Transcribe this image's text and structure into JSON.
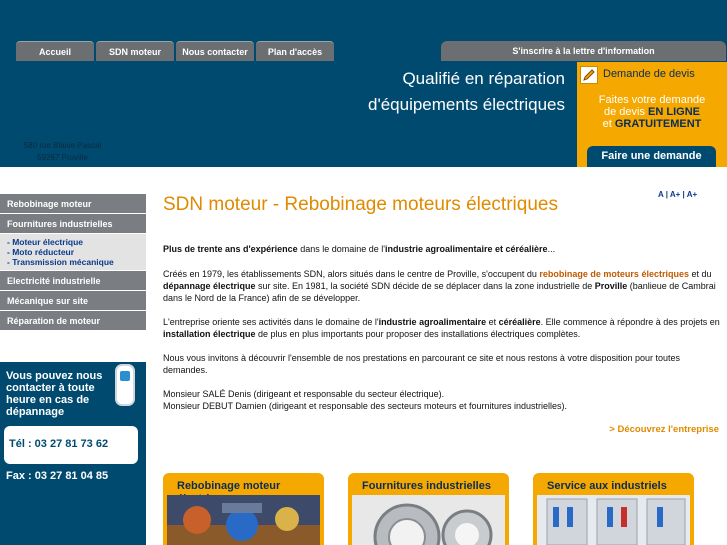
{
  "nav": {
    "tabs": [
      {
        "label": "Accueil"
      },
      {
        "label": "SDN moteur"
      },
      {
        "label": "Nous contacter"
      },
      {
        "label": "Plan d'accès"
      }
    ],
    "newsletter": "S'inscrire à la lettre d'information"
  },
  "header": {
    "tagline_line1": "Qualifié en réparation",
    "tagline_line2": "d'équipements électriques",
    "address_line1": "580 rue Blaise Pascal",
    "address_line2": "59267 Proville"
  },
  "devis": {
    "title": "Demande de devis",
    "text_line1": "Faites votre demande",
    "text_line2_a": "de devis ",
    "text_line2_b": "EN LIGNE",
    "text_line3_a": "et ",
    "text_line3_b": "GRATUITEMENT",
    "button": "Faire une demande"
  },
  "sidebar": {
    "items": [
      {
        "label": "Rebobinage moteur"
      },
      {
        "label": "Fournitures industrielles"
      }
    ],
    "subitems": [
      "- Moteur électrique",
      "- Moto réducteur",
      "- Transmission mécanique"
    ],
    "items_after": [
      {
        "label": "Electricité industrielle"
      },
      {
        "label": "Mécanique sur site"
      },
      {
        "label": "Réparation de moteur"
      }
    ]
  },
  "contact": {
    "text": "Vous pouvez nous contacter à toute heure en cas de dépannage",
    "tel": "Tél : 03 27 81 73 62",
    "fax": "Fax : 03 27 81 04 85"
  },
  "font_tools": {
    "a": "A",
    "sep1": " | ",
    "a_plus": "A+",
    "sep2": " | ",
    "a_plus2": "A+"
  },
  "main": {
    "title": "SDN moteur - Rebobinage moteurs électriques",
    "p1": {
      "b1": "Plus de trente ans d'expérience",
      "t1": " dans le domaine de l'",
      "b2": "industrie agroalimentaire et céréalière",
      "t2": "..."
    },
    "p2": {
      "t1": "Créés en 1979, les établissements SDN, alors situés dans le centre de Proville, s'occupent du ",
      "b1": "rebobinage de moteurs électriques",
      "t2": " et du ",
      "b2": "dépannage électrique",
      "t3": " sur site. En 1981, la société SDN décide de se déplacer dans la zone industrielle de ",
      "b3": "Proville",
      "t4": " (banlieue de Cambrai dans le Nord de la France) afin de se développer."
    },
    "p3": {
      "t1": "L'entreprise oriente ses activités dans le domaine de l'",
      "b1": "industrie agroalimentaire",
      "t2": " et ",
      "b2": "céréalière",
      "t3": ". Elle commence à répondre à des projets en ",
      "b3": "installation électrique",
      "t4": " de plus en plus importants pour proposer des installations électriques complètes."
    },
    "p4": "Nous vous invitons à découvrir l'ensemble de nos prestations en parcourant ce site et nous restons à votre disposition pour toutes demandes.",
    "p5_line1": "Monsieur SALÉ Denis (dirigeant et responsable du secteur électrique).",
    "p5_line2": "Monsieur DEBUT Damien (dirigeant et responsable des secteurs moteurs et fournitures industrielles).",
    "discover": "> Découvrez l'entreprise"
  },
  "cards": [
    {
      "title": "Rebobinage moteur électrique"
    },
    {
      "title": "Fournitures industrielles"
    },
    {
      "title": "Service aux industriels"
    }
  ],
  "colors": {
    "header_blue": "#004a70",
    "accent_orange": "#f5a800",
    "title_orange": "#e08a00"
  }
}
